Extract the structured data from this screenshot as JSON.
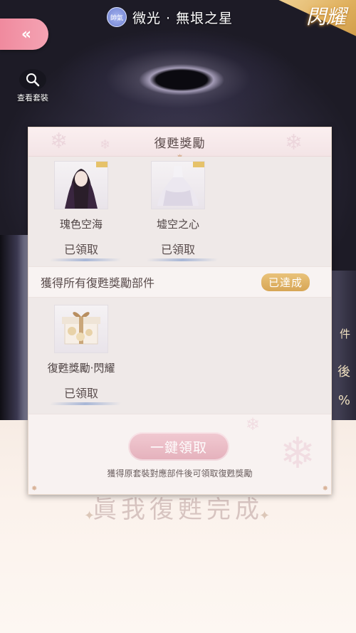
{
  "header": {
    "back_label": "«",
    "title_badge": "帥氣",
    "title": "微光 · 無垠之星",
    "corner_badge": "閃耀",
    "view_outfit_label": "查看套裝"
  },
  "modal": {
    "title": "復甦獎勵",
    "rewards": [
      {
        "name": "瑰色空海",
        "status": "已領取"
      },
      {
        "name": "墟空之心",
        "status": "已領取"
      }
    ],
    "section2": {
      "title": "獲得所有復甦獎勵部件",
      "badge": "已達成",
      "items": [
        {
          "name": "復甦獎勵·閃耀",
          "status": "已領取"
        }
      ]
    },
    "claim_all_label": "一鍵領取",
    "footer_note": "獲得原套裝對應部件後可領取復甦獎勵"
  },
  "background": {
    "bottom_text": "眞我復甦完成",
    "right_side_chars": [
      "件",
      "後",
      "%"
    ]
  },
  "icons": {
    "back": "double-chevron-left-icon",
    "search": "search-icon",
    "snowflake": "snowflake-icon"
  },
  "colors": {
    "accent_pink": "#f08a9e",
    "gold": "#d7a655",
    "modal_bg": "#f6f0ee"
  }
}
